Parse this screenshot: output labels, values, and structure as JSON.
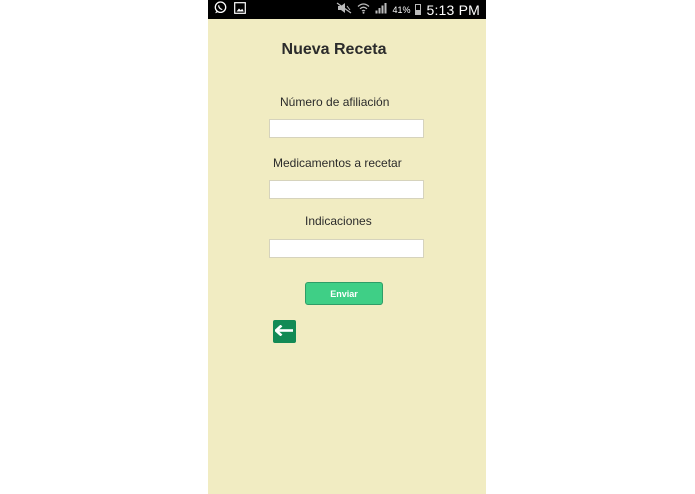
{
  "status_bar": {
    "battery_percent": "41%",
    "battery_level": 0.41,
    "time": "5:13 PM",
    "left_icons": [
      "whatsapp-icon",
      "gallery-icon"
    ],
    "right_icons": [
      "mute-icon",
      "wifi-icon",
      "signal-icon",
      "battery-icon"
    ]
  },
  "form": {
    "title": "Nueva Receta",
    "fields": [
      {
        "label": "Número de afiliación",
        "value": "",
        "placeholder": ""
      },
      {
        "label": "Medicamentos a recetar",
        "value": "",
        "placeholder": ""
      },
      {
        "label": "Indicaciones",
        "value": "",
        "placeholder": ""
      }
    ],
    "submit_label": "Enviar",
    "back_icon": "arrow-left-icon"
  },
  "colors": {
    "background": "#f1ecc2",
    "button": "#3fcf86",
    "back_button": "#138a55",
    "status_bar": "#000000"
  }
}
